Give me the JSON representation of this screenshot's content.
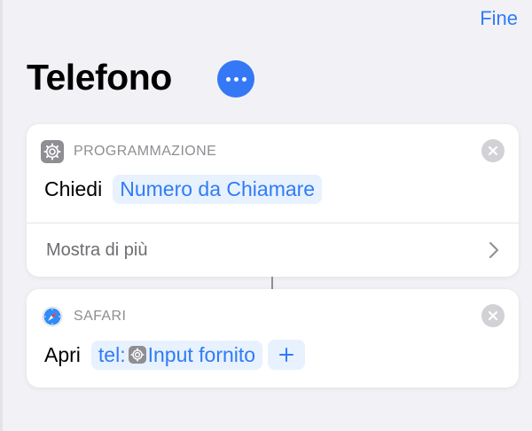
{
  "header": {
    "done_label": "Fine",
    "title": "Telefono"
  },
  "actions": [
    {
      "app": "PROGRAMMAZIONE",
      "icon": "gear-icon",
      "verb": "Chiedi",
      "token": "Numero da Chiamare",
      "show_more_label": "Mostra di più"
    },
    {
      "app": "SAFARI",
      "icon": "safari-compass-icon",
      "verb": "Apri",
      "token_prefix": "tel:",
      "token_icon": "gear-icon",
      "token": "Input fornito"
    }
  ],
  "colors": {
    "accent": "#2f7cf6",
    "background": "#f2f2f6",
    "token_bg": "#e8f1fe"
  }
}
